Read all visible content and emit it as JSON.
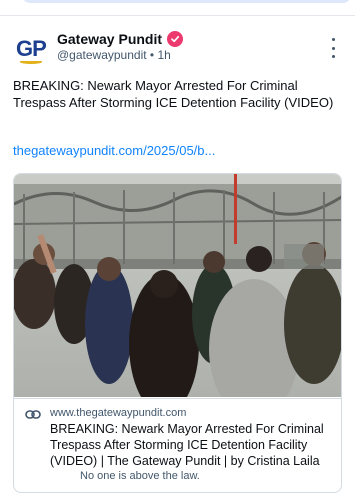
{
  "post": {
    "author_name": "Gateway Pundit",
    "author_handle": "@gatewaypundit",
    "separator": "•",
    "time_ago": "1h",
    "avatar_text": "GP",
    "text": "BREAKING: Newark Mayor Arrested For Criminal Trespass After Storming ICE Detention Facility (VIDEO)",
    "link_text": "thegatewaypundit.com/2025/05/b..."
  },
  "card": {
    "domain": "www.thegatewaypundit.com",
    "title": "BREAKING: Newark Mayor Arrested For Criminal Trespass After Storming ICE Detention Facility (VIDEO) | The Gateway Pundit | by Cristina Laila",
    "description": "No one is above the law."
  },
  "icons": {
    "verified": "verified-badge-icon",
    "more": "more-options-icon",
    "link": "link-icon"
  },
  "colors": {
    "link": "#1083fe",
    "verified": "#ec3a6e",
    "secondary_text": "#42576c"
  }
}
